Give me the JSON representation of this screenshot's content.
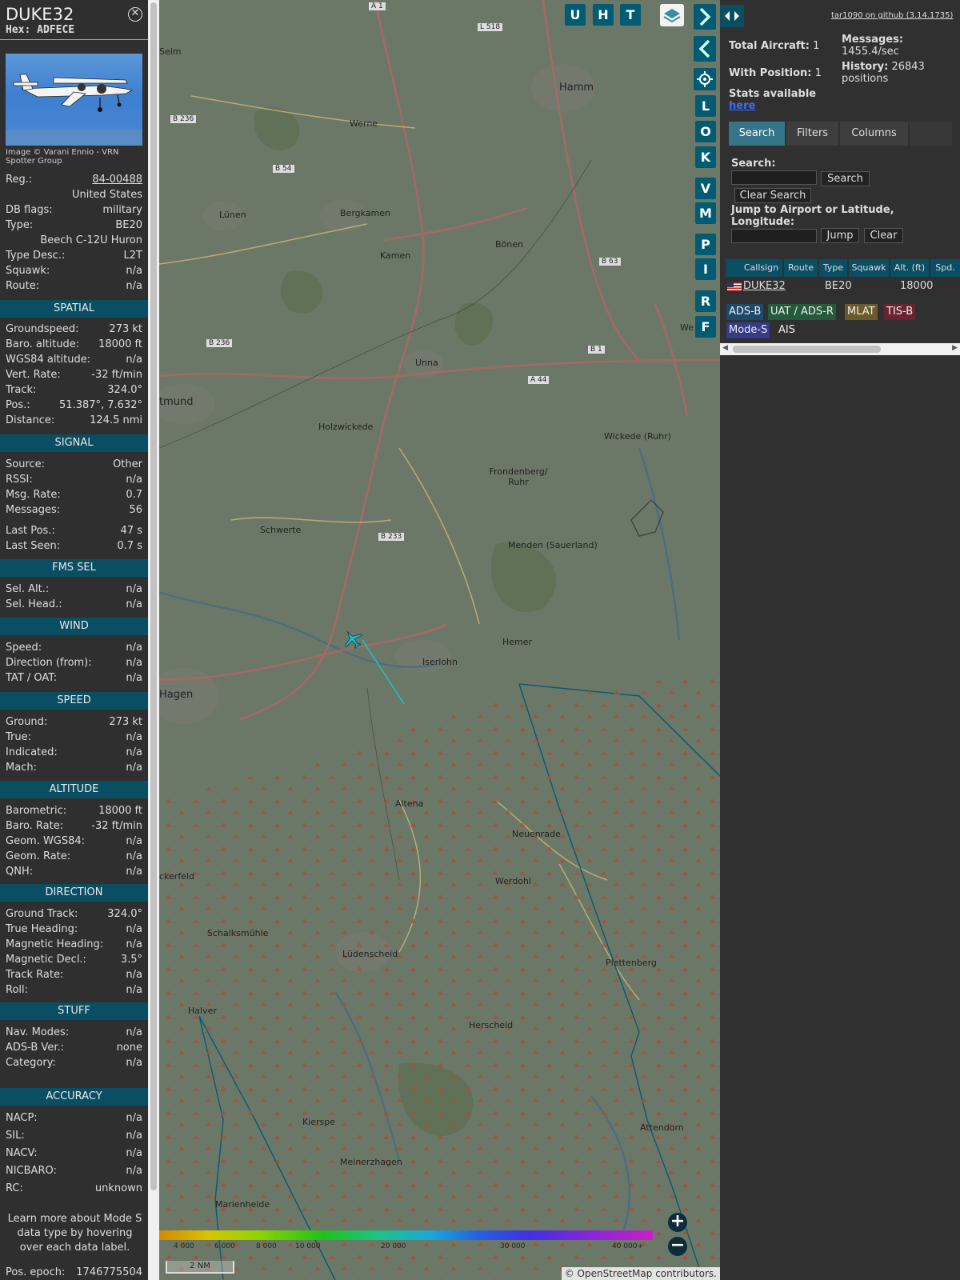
{
  "info": {
    "callsign": "DUKE32",
    "hex_label": "Hex:",
    "hex": "ADFECE",
    "close_icon": "close-icon",
    "photo_credit": "Image © Varani Ennio - VRN Spotter Group",
    "basic": [
      {
        "k": "Reg.:",
        "v": "84-00488"
      },
      {
        "k": "",
        "v": "United States"
      },
      {
        "k": "DB flags:",
        "v": "military"
      },
      {
        "k": "Type:",
        "v": "BE20"
      },
      {
        "k": "",
        "v": "Beech C-12U Huron"
      },
      {
        "k": "Type Desc.:",
        "v": "L2T"
      },
      {
        "k": "Squawk:",
        "v": "n/a"
      },
      {
        "k": "Route:",
        "v": "n/a"
      }
    ],
    "sections": {
      "spatial": {
        "title": "SPATIAL",
        "rows": [
          {
            "k": "Groundspeed:",
            "v": "273 kt"
          },
          {
            "k": "Baro. altitude:",
            "v": "18000 ft"
          },
          {
            "k": "WGS84 altitude:",
            "v": "n/a"
          },
          {
            "k": "Vert. Rate:",
            "v": "-32 ft/min"
          },
          {
            "k": "Track:",
            "v": "324.0°"
          },
          {
            "k": "Pos.:",
            "v": "51.387°, 7.632°"
          },
          {
            "k": "Distance:",
            "v": "124.5 nmi"
          }
        ]
      },
      "signal": {
        "title": "SIGNAL",
        "rows": [
          {
            "k": "Source:",
            "v": "Other"
          },
          {
            "k": "RSSI:",
            "v": "n/a"
          },
          {
            "k": "Msg. Rate:",
            "v": "0.7"
          },
          {
            "k": "Messages:",
            "v": "56"
          },
          {
            "k": "Last Pos.:",
            "v": "47 s"
          },
          {
            "k": "Last Seen:",
            "v": "0.7 s"
          }
        ]
      },
      "fms": {
        "title": "FMS SEL",
        "rows": [
          {
            "k": "Sel. Alt.:",
            "v": "n/a"
          },
          {
            "k": "Sel. Head.:",
            "v": "n/a"
          }
        ]
      },
      "wind": {
        "title": "WIND",
        "rows": [
          {
            "k": "Speed:",
            "v": "n/a"
          },
          {
            "k": "Direction (from):",
            "v": "n/a"
          },
          {
            "k": "TAT / OAT:",
            "v": "n/a"
          }
        ]
      },
      "speed": {
        "title": "SPEED",
        "rows": [
          {
            "k": "Ground:",
            "v": "273 kt"
          },
          {
            "k": "True:",
            "v": "n/a"
          },
          {
            "k": "Indicated:",
            "v": "n/a"
          },
          {
            "k": "Mach:",
            "v": "n/a"
          }
        ]
      },
      "altitude": {
        "title": "ALTITUDE",
        "rows": [
          {
            "k": "Barometric:",
            "v": "18000 ft"
          },
          {
            "k": "Baro. Rate:",
            "v": "-32 ft/min"
          },
          {
            "k": "Geom. WGS84:",
            "v": "n/a"
          },
          {
            "k": "Geom. Rate:",
            "v": "n/a"
          },
          {
            "k": "QNH:",
            "v": "n/a"
          }
        ]
      },
      "direction": {
        "title": "DIRECTION",
        "rows": [
          {
            "k": "Ground Track:",
            "v": "324.0°"
          },
          {
            "k": "True Heading:",
            "v": "n/a"
          },
          {
            "k": "Magnetic Heading:",
            "v": "n/a"
          },
          {
            "k": "Magnetic Decl.:",
            "v": "3.5°"
          },
          {
            "k": "Track Rate:",
            "v": "n/a"
          },
          {
            "k": "Roll:",
            "v": "n/a"
          }
        ]
      },
      "stuff": {
        "title": "STUFF",
        "rows": [
          {
            "k": "Nav. Modes:",
            "v": "n/a"
          },
          {
            "k": "ADS-B Ver.:",
            "v": "none"
          },
          {
            "k": "Category:",
            "v": "n/a"
          }
        ]
      },
      "accuracy": {
        "title": "ACCURACY",
        "rows": [
          {
            "k": "NACP:",
            "v": "n/a"
          },
          {
            "k": "SIL:",
            "v": "n/a"
          },
          {
            "k": "NACV:",
            "v": "n/a"
          },
          {
            "k": "NICBARO:",
            "v": "n/a"
          },
          {
            "k": "RC:",
            "v": "unknown"
          }
        ]
      }
    },
    "learn_more": "Learn more about Mode S data type by hovering over each data label.",
    "pos_epoch_label": "Pos. epoch:",
    "pos_epoch": "1746775504"
  },
  "map": {
    "top_buttons": [
      "U",
      "H",
      "T"
    ],
    "side_buttons": [
      "L",
      "O",
      "K",
      "V",
      "M",
      "P",
      "I",
      "R",
      "F"
    ],
    "layers_icon": "layers-icon",
    "expand_icon": "chevron-right-icon",
    "collapse_icon": "chevron-left-icon",
    "settings_icon": "gear-icon",
    "toggle_icon": "split-arrows-icon",
    "labels": [
      "Selm",
      "Werne",
      "Hamm",
      "Lünen",
      "Bergkamen",
      "Kamen",
      "Bönen",
      "Unna",
      "Holzwickede",
      "Wickede (Ruhr)",
      "Frondenberg/ Ruhr",
      "Schwerte",
      "Menden (Sauerland)",
      "Hemer",
      "Iserlohn",
      "Hagen",
      "Altena",
      "Neuenrade",
      "Werdohl",
      "Schalksmühle",
      "Lüdenscheid",
      "Plettenberg",
      "Halver",
      "Herscheid",
      "Kierspe",
      "Meinerzhagen",
      "Attendorn",
      "Marienheide",
      "ckerfeld",
      "tmund",
      "We"
    ],
    "road_labels": [
      "A 1",
      "L 518",
      "B 236",
      "B 54",
      "B 63",
      "B 236",
      "A 44",
      "B 1",
      "B 233"
    ],
    "altitude_scale": [
      "4 000",
      "6 000",
      "8 000",
      "10 000",
      "20 000",
      "30 000",
      "40 000+"
    ],
    "scale_label": "2 NM",
    "attribution_prefix": "© ",
    "attribution_link": "OpenStreetMap",
    "attribution_suffix": " contributors.",
    "zoom_in": "+",
    "zoom_out": "−"
  },
  "right": {
    "github_link": "tar1090 on github (3.14.1735)",
    "total_aircraft_label": "Total Aircraft:",
    "total_aircraft": "1",
    "with_position_label": "With Position:",
    "with_position": "1",
    "messages_label": "Messages:",
    "messages": "1455.4/sec",
    "history_label": "History:",
    "history": "26843 positions",
    "stats_label": "Stats available",
    "stats_link": "here",
    "tabs": [
      "Search",
      "Filters",
      "Columns"
    ],
    "search_label": "Search:",
    "search_button": "Search",
    "clear_search_button": "Clear Search",
    "jump_label": "Jump to Airport or Latitude, Longitude:",
    "jump_button": "Jump",
    "clear_button": "Clear",
    "table_headers": [
      "Callsign",
      "Route",
      "Type",
      "Squawk",
      "Alt. (ft)",
      "Spd."
    ],
    "table_rows": [
      {
        "flag": "us-flag-icon",
        "callsign": "DUKE32",
        "route": "",
        "type": "BE20",
        "squawk": "",
        "alt": "18000"
      }
    ],
    "source_tags": [
      {
        "label": "ADS-B",
        "color": "#1e4a6a"
      },
      {
        "label": "UAT / ADS-R",
        "color": "#255a3b"
      },
      {
        "label": "MLAT",
        "color": "#6b5a2a"
      },
      {
        "label": "TIS-B",
        "color": "#6a2430"
      },
      {
        "label": "Mode-S",
        "color": "#353a8a"
      },
      {
        "label": "AIS",
        "color": "#303030"
      }
    ]
  },
  "colors": {
    "panel_bg": "#2f2f2f",
    "section_bg": "#0a4e63",
    "button_bg": "#005b73",
    "map_bg": "#6c7867",
    "track_color": "#19c4c4"
  }
}
